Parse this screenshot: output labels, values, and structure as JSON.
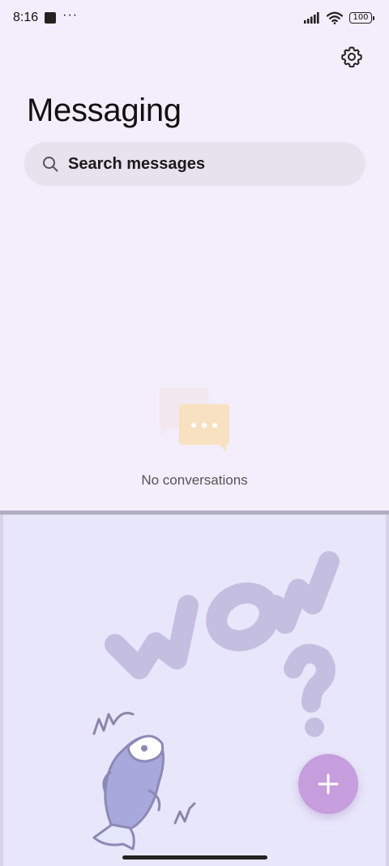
{
  "status_bar": {
    "time": "8:16",
    "overflow": "···",
    "battery": "100"
  },
  "header": {
    "title": "Messaging",
    "settings_icon": "gear-icon"
  },
  "search": {
    "placeholder": "Search messages",
    "icon": "search-icon"
  },
  "empty_state": {
    "icon": "chat-bubbles-icon",
    "caption": "No conversations"
  },
  "fab": {
    "icon": "plus-icon"
  },
  "colors": {
    "background": "#f4edfb",
    "search_bg": "#e8e1ee",
    "lower_panel_bg": "#e8e6fa",
    "fab": "#c69ddd",
    "divider": "#b2acc1"
  }
}
